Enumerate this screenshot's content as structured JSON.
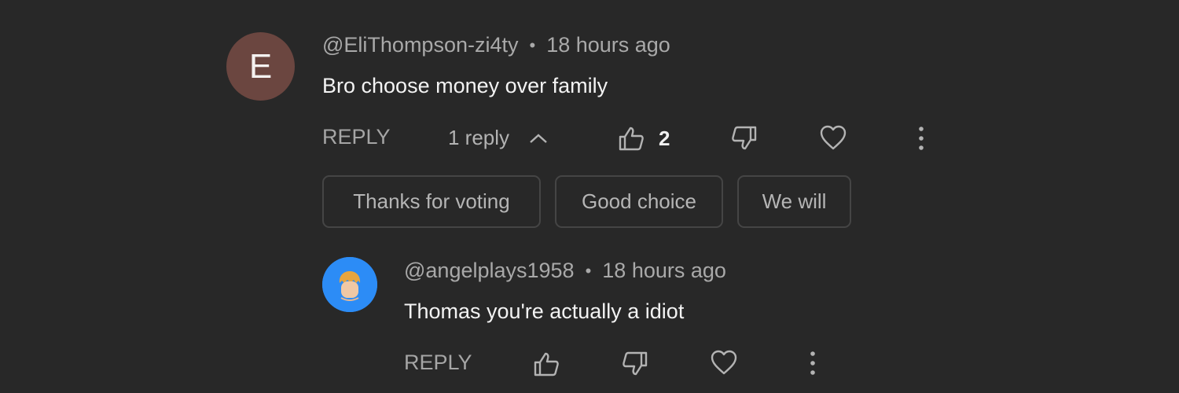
{
  "comment": {
    "avatar_letter": "E",
    "author": "@EliThompson-zi4ty",
    "separator": "•",
    "time": "18 hours ago",
    "text": "Bro choose money over family",
    "reply_label": "REPLY",
    "replies_label": "1 reply",
    "like_count": "2",
    "chips": [
      "Thanks for voting",
      "Good choice",
      "We will"
    ]
  },
  "reply": {
    "author": "@angelplays1958",
    "separator": "•",
    "time": "18 hours ago",
    "text": "Thomas you're actually a idiot",
    "reply_label": "REPLY"
  },
  "icons": {
    "like": "thumbs-up-icon",
    "dislike": "thumbs-down-icon",
    "heart": "heart-icon",
    "more": "more-vert-icon",
    "chevron": "chevron-up-icon"
  },
  "colors": {
    "background": "#282828",
    "avatar_e": "#6b4640",
    "avatar_reply": "#2c8cf6"
  }
}
